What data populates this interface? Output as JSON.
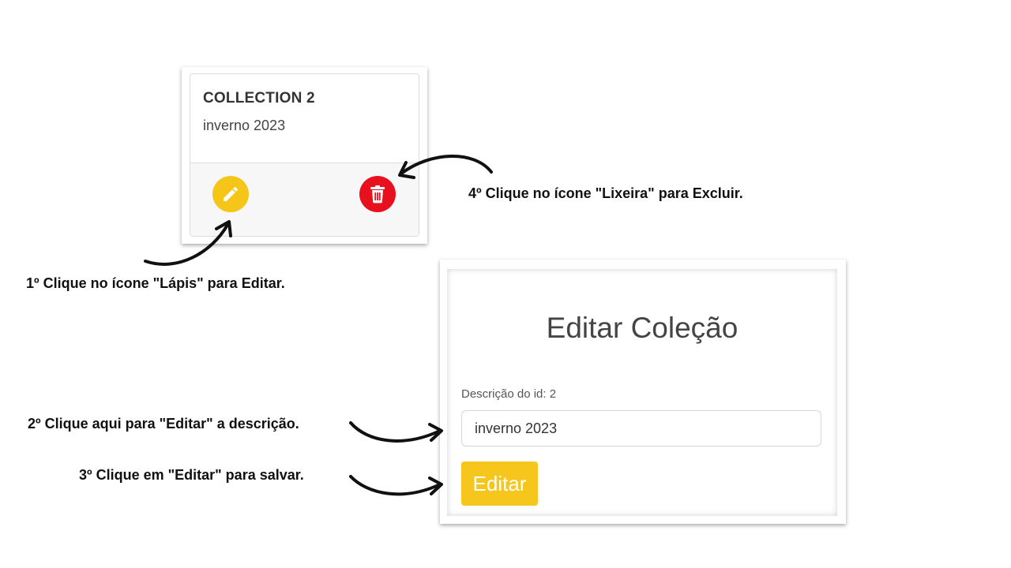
{
  "card": {
    "title": "COLLECTION 2",
    "description": "inverno 2023",
    "edit_icon": "pencil-icon",
    "delete_icon": "trash-icon",
    "colors": {
      "edit": "#f5c518",
      "delete": "#e8101c"
    }
  },
  "form": {
    "title": "Editar Coleção",
    "field_label": "Descrição do id: 2",
    "field_value": "inverno 2023",
    "submit_label": "Editar",
    "colors": {
      "submit": "#f7c61c"
    }
  },
  "annotations": {
    "step1": "1º Clique no ícone \"Lápis\" para Editar.",
    "step2": "2º Clique aqui para \"Editar\" a descrição.",
    "step3": "3º Clique em \"Editar\" para salvar.",
    "step4": "4º Clique no ícone \"Lixeira\" para Excluir."
  }
}
